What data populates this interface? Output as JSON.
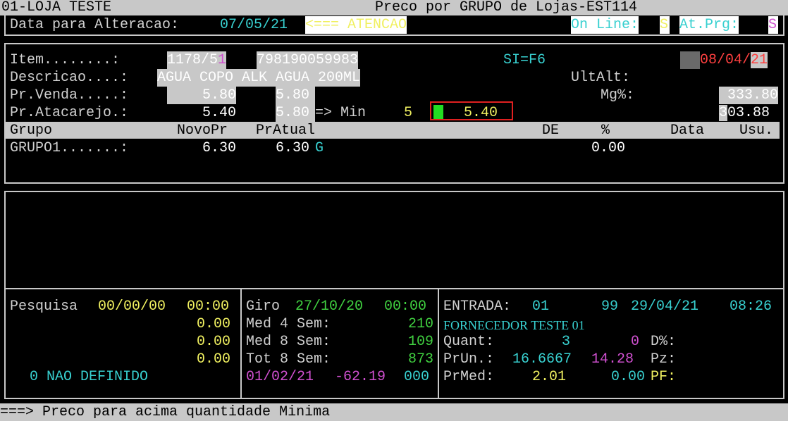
{
  "header": {
    "store": "01-LOJA TESTE",
    "title": "Preco por GRUPO de Lojas-EST114"
  },
  "top": {
    "date_label": "Data para Alteracao:",
    "date_value": "07/05/21",
    "warning": "<=== ATENCAO",
    "online_label": "On Line:",
    "online_value": "S",
    "atprg_label": "At.Prg:",
    "atprg_value": "S"
  },
  "item": {
    "label": "Item........:",
    "code_a": "1178/5",
    "code_b": "1",
    "barcode": "798190059983",
    "si": "SI=F6",
    "date_d": "08/04",
    "date_sep": "/",
    "date_y": "21"
  },
  "descricao": {
    "label": "Descricao....:",
    "value": "AGUA COPO ALK AGUA 200ML",
    "ultalt_label": "UltAlt:"
  },
  "venda": {
    "label": "Pr.Venda.....:",
    "novo": "5.80",
    "atual": "5.80",
    "mg_label": "Mg%:",
    "mg_value": "333.80"
  },
  "atacarejo": {
    "label": "Pr.Atacarejo.:",
    "novo": "5.40",
    "atual": "5.80",
    "arrow": "=> Min",
    "min_qty": "5",
    "min_price": "5.40",
    "mg_first": "3",
    "mg_rest": "03.88"
  },
  "grid": {
    "headers": {
      "grupo": "Grupo",
      "novopr": "NovoPr",
      "pratual": "PrAtual",
      "de": "DE",
      "pct": "%",
      "data": "Data",
      "usu": "Usu."
    },
    "rows": [
      {
        "grupo": "GRUPO1.......:",
        "novopr": "6.30",
        "pratual": "6.30",
        "flag": "G",
        "pct": "0.00"
      }
    ]
  },
  "pesquisa": {
    "label": "Pesquisa",
    "date": "00/00/00",
    "time": "00:00",
    "values": [
      "0.00",
      "0.00",
      "0.00"
    ],
    "status": "0 NAO DEFINIDO"
  },
  "giro": {
    "label": "Giro",
    "date": "27/10/20",
    "time": "00:00",
    "med4_label": "Med 4 Sem:",
    "med4": "210",
    "med8_label": "Med 8 Sem:",
    "med8": "109",
    "tot8_label": "Tot 8 Sem:",
    "tot8": "873",
    "last_date": "01/02/21",
    "last_value": "-62.19",
    "last_code": "000"
  },
  "entrada": {
    "label": "ENTRADA:",
    "store": "01",
    "code": "99",
    "date": "29/04/21",
    "time": "08:26",
    "supplier": "FORNECEDOR TESTE 01",
    "quant_label": "Quant:",
    "quant": "3",
    "quant2": "0",
    "dpct_label": "D%:",
    "prun_label": "PrUn.:",
    "prun": "16.6667",
    "prun_pct": "14.28",
    "pz_label": "Pz:",
    "prmed_label": "PrMed:",
    "prmed": "2.01",
    "prmed2": "0.00",
    "pf_label": "PF:"
  },
  "footer": {
    "message": "===> Preco para acima quantidade Minima"
  }
}
